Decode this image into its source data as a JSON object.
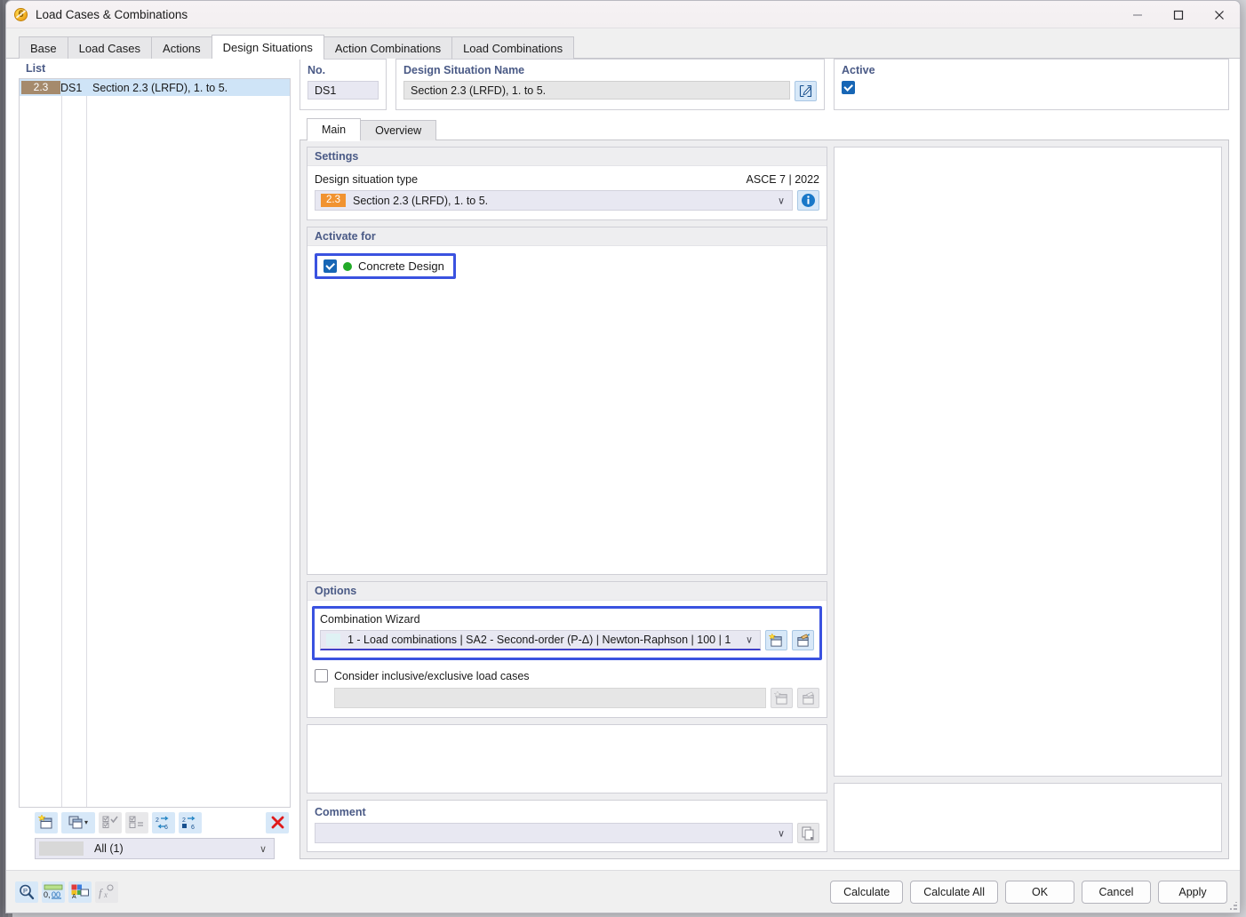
{
  "window": {
    "title": "Load Cases & Combinations",
    "icon": "app-badge-6-icon",
    "minimize": "–",
    "maximize": "□",
    "close": "✕"
  },
  "tabs": [
    {
      "label": "Base",
      "active": false
    },
    {
      "label": "Load Cases",
      "active": false
    },
    {
      "label": "Actions",
      "active": false
    },
    {
      "label": "Design Situations",
      "active": true
    },
    {
      "label": "Action Combinations",
      "active": false
    },
    {
      "label": "Load Combinations",
      "active": false
    }
  ],
  "list": {
    "title": "List",
    "rows": [
      {
        "badge": "2.3",
        "no": "DS1",
        "description": "Section 2.3 (LRFD), 1. to 5.",
        "selected": true
      }
    ],
    "toolbar": [
      {
        "name": "new-item-button",
        "icon": "new-window-star-icon",
        "enabled": true
      },
      {
        "name": "copy-item-button",
        "icon": "copy-window-icon",
        "enabled": true,
        "caret": "▾"
      },
      {
        "name": "select-all-button",
        "icon": "check-all-icon",
        "enabled": false
      },
      {
        "name": "invert-selection-button",
        "icon": "invert-check-icon",
        "enabled": false
      },
      {
        "name": "renumber-button",
        "icon": "renumber-arrows-icon",
        "enabled": true
      },
      {
        "name": "renumber-selected-button",
        "icon": "renumber-selected-icon",
        "enabled": true
      },
      {
        "name": "delete-item-button",
        "icon": "red-x-icon",
        "enabled": true
      }
    ],
    "filter": {
      "label": "All (1)",
      "caret": "∨"
    }
  },
  "header": {
    "no": {
      "label": "No.",
      "value": "DS1"
    },
    "name": {
      "label": "Design Situation Name",
      "value": "Section 2.3 (LRFD), 1. to 5.",
      "edit_icon": "edit-pencil-icon"
    },
    "active": {
      "label": "Active",
      "checked": true
    }
  },
  "inner_tabs": [
    {
      "label": "Main",
      "active": true
    },
    {
      "label": "Overview",
      "active": false
    }
  ],
  "settings": {
    "title": "Settings",
    "type_label": "Design situation type",
    "standard": "ASCE 7 | 2022",
    "type_badge": "2.3",
    "type_value": "Section 2.3 (LRFD), 1. to 5.",
    "caret": "∨",
    "info_icon": "info-circle-icon"
  },
  "activate_for": {
    "title": "Activate for",
    "items": [
      {
        "label": "Concrete Design",
        "checked": true,
        "status_color": "#22aa28",
        "highlighted": true
      }
    ]
  },
  "options": {
    "title": "Options",
    "wizard": {
      "label": "Combination Wizard",
      "value": "1 - Load combinations | SA2 - Second-order (P-Δ) | Newton-Raphson | 100 | 1",
      "caret": "∨",
      "new_icon": "new-window-star-icon",
      "edit_icon": "edit-window-icon",
      "highlighted": true
    },
    "inclusive": {
      "label": "Consider inclusive/exclusive load cases",
      "checked": false,
      "value": "",
      "caret": "",
      "new_icon": "new-window-star-icon",
      "edit_icon": "edit-window-icon"
    }
  },
  "comment": {
    "label": "Comment",
    "value": "",
    "caret": "∨",
    "copy_icon": "copy-pages-icon"
  },
  "footer": {
    "tools": [
      {
        "name": "find-zoom-button",
        "icon": "magnifier-icon",
        "enabled": true
      },
      {
        "name": "decimal-places-button",
        "icon": "decimals-0-00-icon",
        "enabled": true
      },
      {
        "name": "rename-button",
        "icon": "rename-label-icon",
        "enabled": true
      },
      {
        "name": "formula-button",
        "icon": "function-fx-icon",
        "enabled": false
      }
    ],
    "buttons": [
      {
        "label": "Calculate",
        "name": "calculate-button"
      },
      {
        "label": "Calculate All",
        "name": "calculate-all-button"
      },
      {
        "label": "OK",
        "name": "ok-button"
      },
      {
        "label": "Cancel",
        "name": "cancel-button"
      },
      {
        "label": "Apply",
        "name": "apply-button"
      }
    ]
  },
  "colors": {
    "accent": "#1766b5",
    "highlight": "#3a52e0",
    "badge_orange": "#f19331",
    "badge_brown": "#a58a6c",
    "status_green": "#22aa28",
    "label_blue": "#4a5a86"
  }
}
